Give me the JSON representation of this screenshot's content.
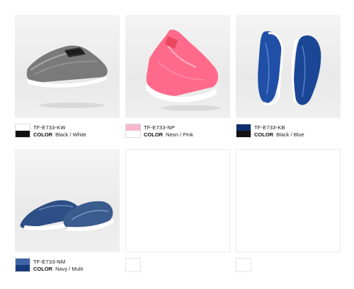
{
  "products": [
    {
      "code": "TF-E733-KW",
      "color_label": "COLOR",
      "color_value": "Black / White",
      "swatch_top": "#ffffff",
      "swatch_bottom": "#111111",
      "shoe_color": "#6f6f6f",
      "image": "grey-white-sneaker"
    },
    {
      "code": "TF-E733-NP",
      "color_label": "COLOR",
      "color_value": "Neon / Pink",
      "swatch_top": "#f7b7cf",
      "swatch_bottom": "#ffffff",
      "shoe_color": "#ff5a7e",
      "image": "neon-pink-sneaker"
    },
    {
      "code": "TF-E733-KB",
      "color_label": "COLOR",
      "color_value": "Black / Blue",
      "swatch_top": "#0d2f6e",
      "swatch_bottom": "#111111",
      "shoe_color": "#1d4ea3",
      "image": "blue-sneaker-pair"
    },
    {
      "code": "TF-E733-NM",
      "color_label": "COLOR",
      "color_value": "Navy / Multi",
      "swatch_top": "#3e64a8",
      "swatch_bottom": "#173a7a",
      "shoe_color": "#2b4f86",
      "image": "navy-sneaker-pair"
    }
  ]
}
